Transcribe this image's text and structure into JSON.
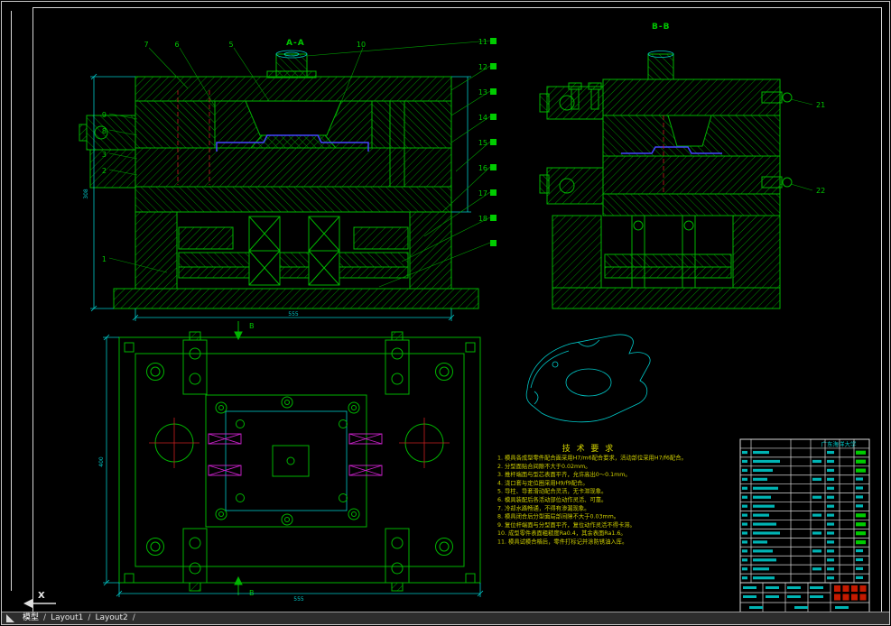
{
  "window": {
    "tabs": [
      {
        "label": "模型",
        "active": true
      },
      {
        "label": "Layout1",
        "active": false
      },
      {
        "label": "Layout2",
        "active": false
      }
    ],
    "tab_separator": "/",
    "ucs_label": "X"
  },
  "views": {
    "section_a": {
      "label": "A-A",
      "balloons_top": [
        "7",
        "6",
        "5"
      ],
      "balloon_right": "10",
      "balloons_left": [
        "9",
        "8",
        "3",
        "2"
      ],
      "balloon_bottom": "1",
      "dim_left": "308",
      "dim_bottom": "555"
    },
    "section_b": {
      "label": "B-B",
      "balloons_right": [
        "21",
        "22"
      ]
    },
    "balloon_column": [
      "11",
      "12",
      "13",
      "14",
      "15",
      "16",
      "17",
      "18"
    ],
    "plan": {
      "section_mark": "B",
      "dim_left": "400",
      "dim_bottom": "555"
    }
  },
  "tech_requirements": {
    "title": "技 术 要 求",
    "lines": [
      "1. 模具各成型零件配合面采用H7/m6配合要求，活动部位采用H7/f6配合。",
      "2. 分型面贴合间隙不大于0.02mm。",
      "3. 推杆端面与型芯表面平齐，允许高出0～0.1mm。",
      "4. 浇口套与定位圈采用H9/f9配合。",
      "5. 导柱、导套滑动配合灵活，无卡滞现象。",
      "6. 模具装配后各活动部位动作灵活、可靠。",
      "7. 冷却水路畅通，不得有渗漏现象。",
      "8. 模具闭合后分型面局部间隙不大于0.03mm。",
      "9. 复位杆端面与分型面平齐，复位动作灵活不得卡滞。",
      "10. 成型零件表面粗糙度Ra0.4，其余表面Ra1.6。",
      "11. 模具试模合格后，零件打标记并涂防锈油入库。"
    ]
  },
  "title_block": {
    "school": "广东海洋大学"
  }
}
